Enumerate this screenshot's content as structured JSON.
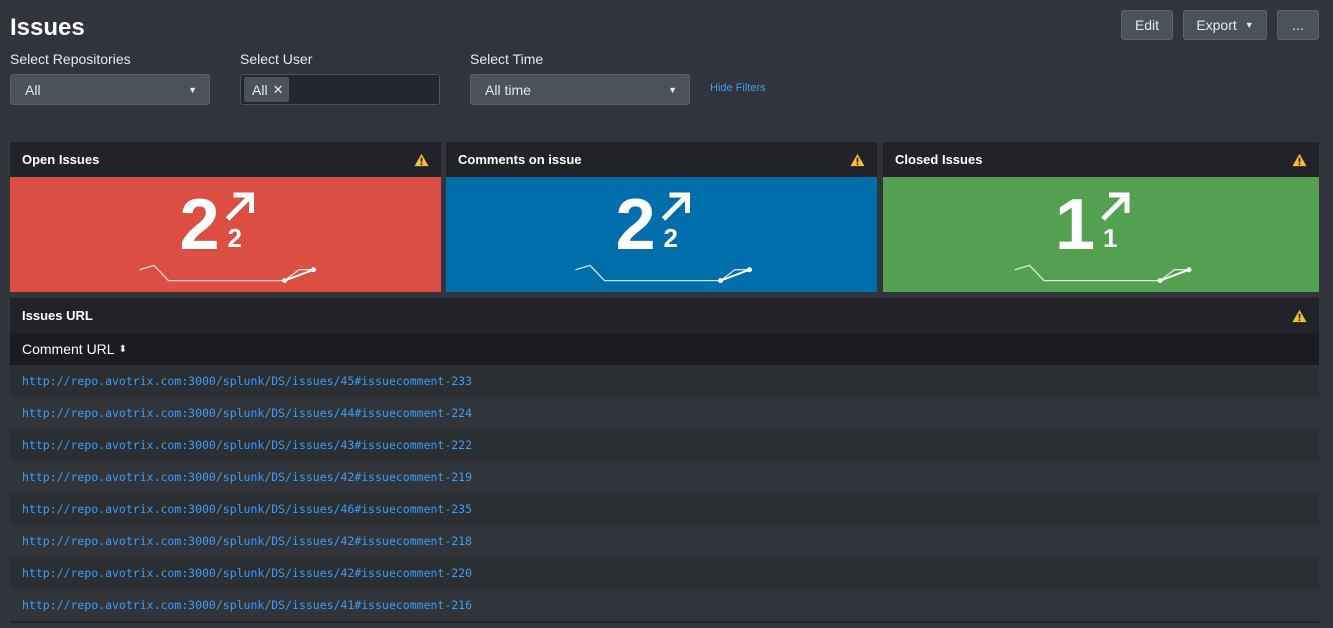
{
  "page": {
    "title": "Issues"
  },
  "toolbar": {
    "edit_label": "Edit",
    "export_label": "Export",
    "more_label": "..."
  },
  "filters": {
    "repositories": {
      "label": "Select Repositories",
      "value": "All"
    },
    "user": {
      "label": "Select User",
      "chip": "All"
    },
    "time": {
      "label": "Select Time",
      "value": "All time"
    },
    "hide_label": "Hide Filters"
  },
  "kpis": [
    {
      "title": "Open Issues",
      "value": "2",
      "delta": "2",
      "color": "#dc4e41",
      "trend": [
        2,
        2.2,
        1.5,
        1.5,
        1.5,
        1.5,
        1.5,
        1.5,
        1.5,
        1.5,
        1.5,
        2,
        2
      ]
    },
    {
      "title": "Comments on issue",
      "value": "2",
      "delta": "2",
      "color": "#006eaa",
      "trend": [
        2,
        2.2,
        1.5,
        1.5,
        1.5,
        1.5,
        1.5,
        1.5,
        1.5,
        1.5,
        1.5,
        2,
        2
      ]
    },
    {
      "title": "Closed Issues",
      "value": "1",
      "delta": "1",
      "color": "#53a051",
      "trend": [
        2,
        2.2,
        1.5,
        1.5,
        1.5,
        1.5,
        1.5,
        1.5,
        1.5,
        1.5,
        1.5,
        2,
        2
      ]
    }
  ],
  "colors": {
    "warning": "#f8be34",
    "link": "#3b9ff5"
  },
  "table": {
    "title": "Issues URL",
    "column": "Comment URL",
    "rows": [
      "http://repo.avotrix.com:3000/splunk/DS/issues/45#issuecomment-233",
      "http://repo.avotrix.com:3000/splunk/DS/issues/44#issuecomment-224",
      "http://repo.avotrix.com:3000/splunk/DS/issues/43#issuecomment-222",
      "http://repo.avotrix.com:3000/splunk/DS/issues/42#issuecomment-219",
      "http://repo.avotrix.com:3000/splunk/DS/issues/46#issuecomment-235",
      "http://repo.avotrix.com:3000/splunk/DS/issues/42#issuecomment-218",
      "http://repo.avotrix.com:3000/splunk/DS/issues/42#issuecomment-220",
      "http://repo.avotrix.com:3000/splunk/DS/issues/41#issuecomment-216"
    ]
  }
}
